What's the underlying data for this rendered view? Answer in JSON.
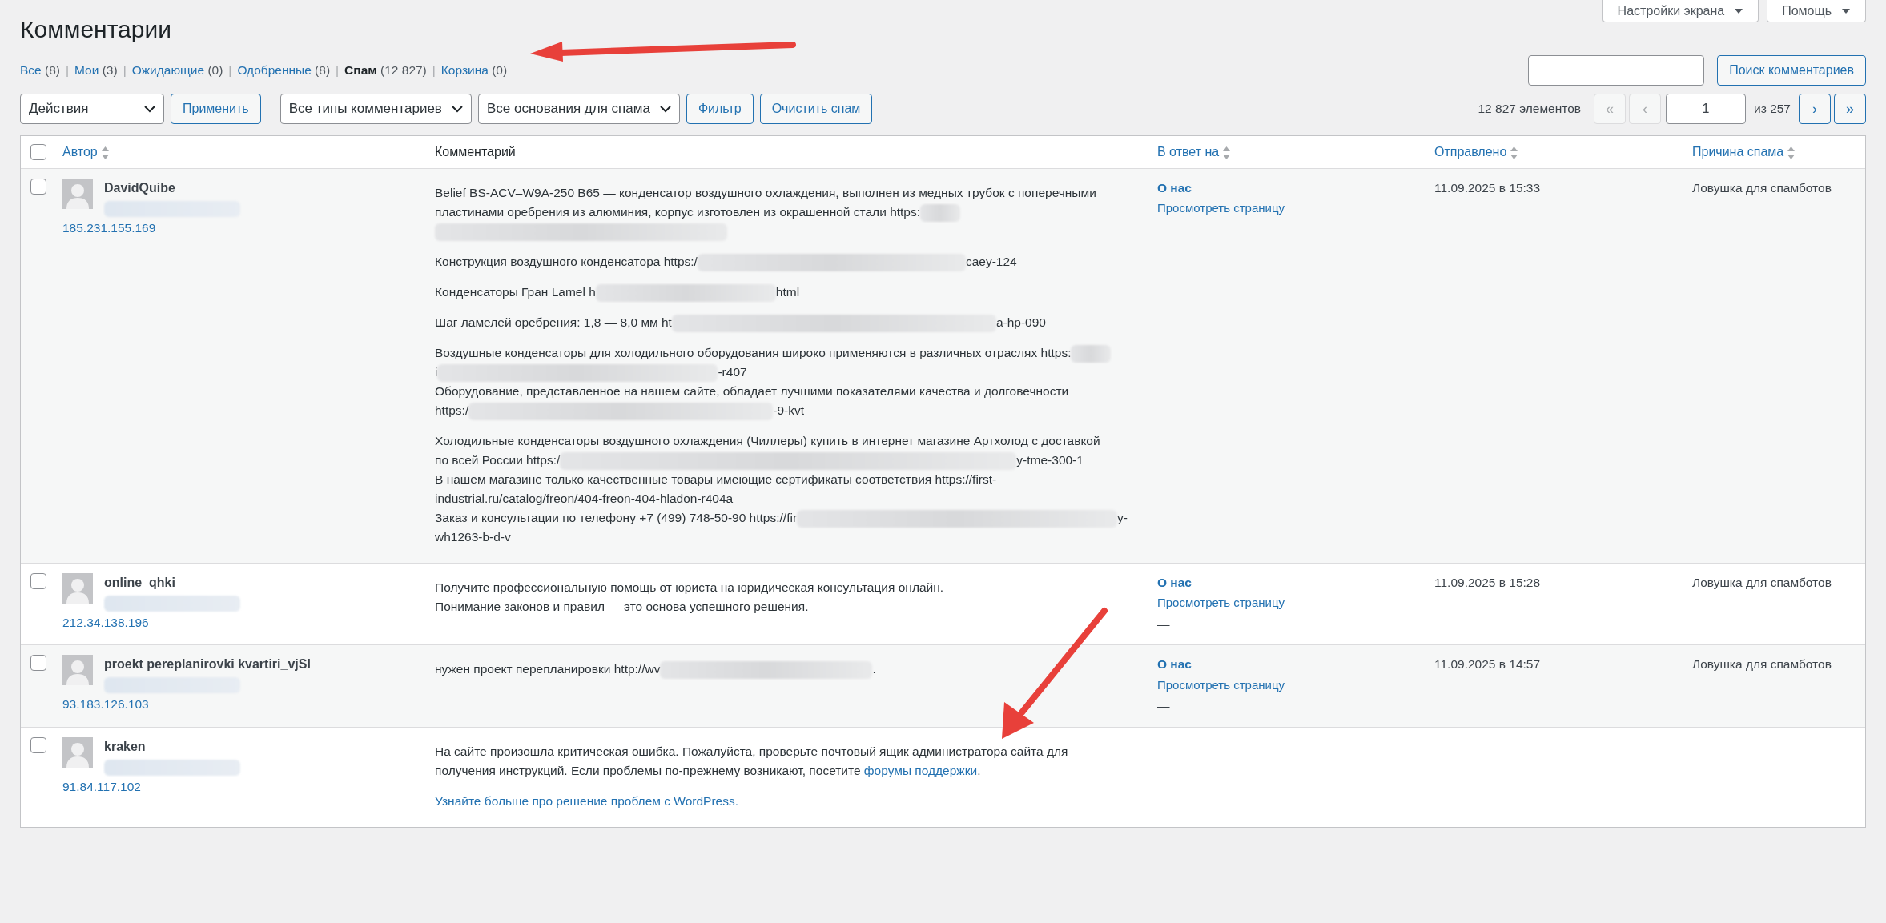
{
  "screen_meta": [
    {
      "label": "Настройки экрана"
    },
    {
      "label": "Помощь"
    }
  ],
  "title": "Комментарии",
  "filters": [
    {
      "label": "Все",
      "count": "(8)",
      "selected": false
    },
    {
      "separator": "|",
      "label": "Мои",
      "count": "(3)",
      "selected": false
    },
    {
      "separator": "|",
      "label": "Ожидающие",
      "count": "(0)",
      "selected": false
    },
    {
      "separator": "|",
      "label": "Одобренные",
      "count": "(8)",
      "selected": false
    },
    {
      "separator": "|",
      "label": "Спам",
      "count": "(12 827)",
      "selected": true
    },
    {
      "separator": "|",
      "label": "Корзина",
      "count": "(0)",
      "selected": false
    }
  ],
  "search": {
    "button": "Поиск комментариев"
  },
  "toolbar": {
    "bulk_action": "Действия",
    "apply": "Применить",
    "type_filter": "Все типы комментариев",
    "reason_filter": "Все основания для спама",
    "filter": "Фильтр",
    "empty_spam": "Очистить спам"
  },
  "pagination": {
    "count": "12 827 элементов",
    "first": {
      "label": "«",
      "disabled": true
    },
    "prev": {
      "label": "‹",
      "disabled": true
    },
    "page": "1",
    "of": "из 257",
    "next": {
      "label": "›",
      "disabled": false
    },
    "last": {
      "label": "»",
      "disabled": false
    }
  },
  "select_all": {
    "checked": false
  },
  "columns": [
    {
      "label": "Автор",
      "sortable": true
    },
    {
      "label": "Комментарий",
      "sortable": false
    },
    {
      "label": "В ответ на",
      "sortable": true
    },
    {
      "label": "Отправлено",
      "sortable": true
    },
    {
      "label": "Причина спама",
      "sortable": true
    }
  ],
  "rows": [
    {
      "checked": false,
      "author": "DavidQuibe",
      "ip": "185.231.155.169",
      "paragraphs": [
        [
          [
            {
              "kind": "text",
              "text": "Belief BS-ACV–W9A-250 B65 — конденсатор воздушного охлаждения, выполнен из медных трубок с поперечными"
            }
          ],
          [
            {
              "kind": "text",
              "text": "пластинами оребрения из алюминия, корпус изготовлен из окрашенной стали https:"
            },
            {
              "kind": "blur"
            }
          ],
          [
            {
              "kind": "blur"
            }
          ]
        ],
        [
          [
            {
              "kind": "text",
              "text": "Конструкция воздушного конденсатора https:/"
            },
            {
              "kind": "blur"
            },
            {
              "kind": "text",
              "text": "caey-124"
            }
          ]
        ],
        [
          [
            {
              "kind": "text",
              "text": "Конденсаторы Гран Lamel h"
            },
            {
              "kind": "blur"
            },
            {
              "kind": "text",
              "text": "html"
            }
          ]
        ],
        [
          [
            {
              "kind": "text",
              "text": "Шаг ламелей оребрения: 1,8 — 8,0 мм ht"
            },
            {
              "kind": "blur"
            },
            {
              "kind": "text",
              "text": "a-hp-090"
            }
          ]
        ],
        [
          [
            {
              "kind": "text",
              "text": "Воздушные конденсаторы для холодильного оборудования широко применяются в различных отраслях https:"
            },
            {
              "kind": "blur"
            }
          ],
          [
            {
              "kind": "text",
              "text": "i"
            },
            {
              "kind": "blur"
            },
            {
              "kind": "text",
              "text": "-r407"
            }
          ],
          [
            {
              "kind": "text",
              "text": "Оборудование, представленное на нашем сайте, обладает лучшими показателями качества и долговечности"
            }
          ],
          [
            {
              "kind": "text",
              "text": "https:/"
            },
            {
              "kind": "blur"
            },
            {
              "kind": "text",
              "text": "-9-kvt"
            }
          ]
        ],
        [
          [
            {
              "kind": "text",
              "text": "Холодильные конденсаторы воздушного охлаждения (Чиллеры) купить в интернет магазине Артхолод с доставкой"
            }
          ],
          [
            {
              "kind": "text",
              "text": "по всей России https:/"
            },
            {
              "kind": "blur"
            },
            {
              "kind": "text",
              "text": "y-tme-300-1"
            }
          ],
          [
            {
              "kind": "text",
              "text": "В нашем магазине только качественные товары имеющие сертификаты соответствия https://first-"
            }
          ],
          [
            {
              "kind": "text",
              "text": "industrial.ru/catalog/freon/404-freon-404-hladon-r404a"
            }
          ],
          [
            {
              "kind": "text",
              "text": "Заказ и консультации по телефону +7 (499) 748-50-90 https://fir"
            },
            {
              "kind": "blur"
            },
            {
              "kind": "text",
              "text": "y-"
            }
          ],
          [
            {
              "kind": "text",
              "text": "wh1263-b-d-v"
            }
          ]
        ]
      ],
      "in_response_to": "О нас",
      "view_page": "Просмотреть страницу",
      "dash": "—",
      "submitted": "11.09.2025 в 15:33",
      "reason": "Ловушка для спамботов"
    },
    {
      "checked": false,
      "author": "online_qhki",
      "ip": "212.34.138.196",
      "paragraphs": [
        [
          [
            {
              "kind": "text",
              "text": "Получите профессиональную помощь от юриста на юридическая консультация онлайн."
            }
          ],
          [
            {
              "kind": "text",
              "text": "Понимание законов и правил — это основа успешного решения."
            }
          ]
        ]
      ],
      "in_response_to": "О нас",
      "view_page": "Просмотреть страницу",
      "dash": "—",
      "submitted": "11.09.2025 в 15:28",
      "reason": "Ловушка для спамботов"
    },
    {
      "checked": false,
      "author": "proekt pereplanirovki kvartiri_vjSl",
      "ip": "93.183.126.103",
      "paragraphs": [
        [
          [
            {
              "kind": "text",
              "text": "нужен проект перепланировки http://wv"
            },
            {
              "kind": "blur"
            },
            {
              "kind": "text",
              "text": "."
            }
          ]
        ]
      ],
      "in_response_to": "О нас",
      "view_page": "Просмотреть страницу",
      "dash": "—",
      "submitted": "11.09.2025 в 14:57",
      "reason": "Ловушка для спамботов"
    },
    {
      "checked": false,
      "author": "kraken",
      "ip": "91.84.117.102",
      "paragraphs": [
        [
          [
            {
              "kind": "text",
              "text": "На сайте произошла критическая ошибка. Пожалуйста, проверьте почтовый ящик администратора сайта для"
            }
          ],
          [
            {
              "kind": "text",
              "text": "получения инструкций. Если проблемы по-прежнему возникают, посетите "
            },
            {
              "kind": "link",
              "text": "форумы поддержки"
            },
            {
              "kind": "text",
              "text": "."
            }
          ]
        ],
        [
          [
            {
              "kind": "link",
              "text": "Узнайте больше про решение проблем с WordPress."
            }
          ]
        ]
      ]
    }
  ]
}
